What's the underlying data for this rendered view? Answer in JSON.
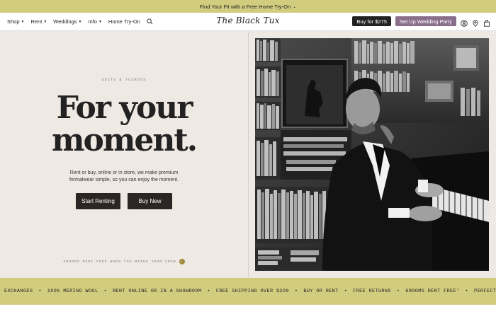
{
  "announcement": {
    "text": "Find Your Fit with a Free Home Try-On",
    "chevron": "⌄"
  },
  "nav": {
    "items": [
      {
        "label": "Shop",
        "caret": true
      },
      {
        "label": "Rent",
        "caret": true
      },
      {
        "label": "Weddings",
        "caret": true
      },
      {
        "label": "Info",
        "caret": true
      },
      {
        "label": "Home Try-On",
        "caret": false
      }
    ],
    "logo": "The Black Tux",
    "buy_button": "Buy for $275",
    "wedding_button": "Set Up Wedding Party",
    "icons": [
      "search-icon",
      "user-icon",
      "location-icon",
      "bag-icon"
    ]
  },
  "hero": {
    "eyebrow": "SUITS & TUXEDOS",
    "headline_line1": "For your",
    "headline_line2": "moment.",
    "subtext": "Rent or buy, online or in store, we make premium formalwear simple, so you can enjoy the moment.",
    "cta_rent": "Start Renting",
    "cta_buy": "Buy New",
    "footnote": "GROOMS RENT FREE WHEN YOU BRING YOUR CREW",
    "footnote_icon": "›"
  },
  "ticker": {
    "items": [
      "EXCHANGES",
      "100% MERINO WOOL",
      "RENT ONLINE OR IN A SHOWROOM",
      "FREE SHIPPING OVER $200",
      "BUY OR RENT",
      "FREE RETURNS",
      "GROOMS RENT FREE'",
      "PERFECT FI"
    ],
    "separator": "•"
  },
  "colors": {
    "accent_yellow": "#d2cc7f",
    "dark": "#222222",
    "purple": "#8a6f8c",
    "background": "#efe9e4"
  }
}
